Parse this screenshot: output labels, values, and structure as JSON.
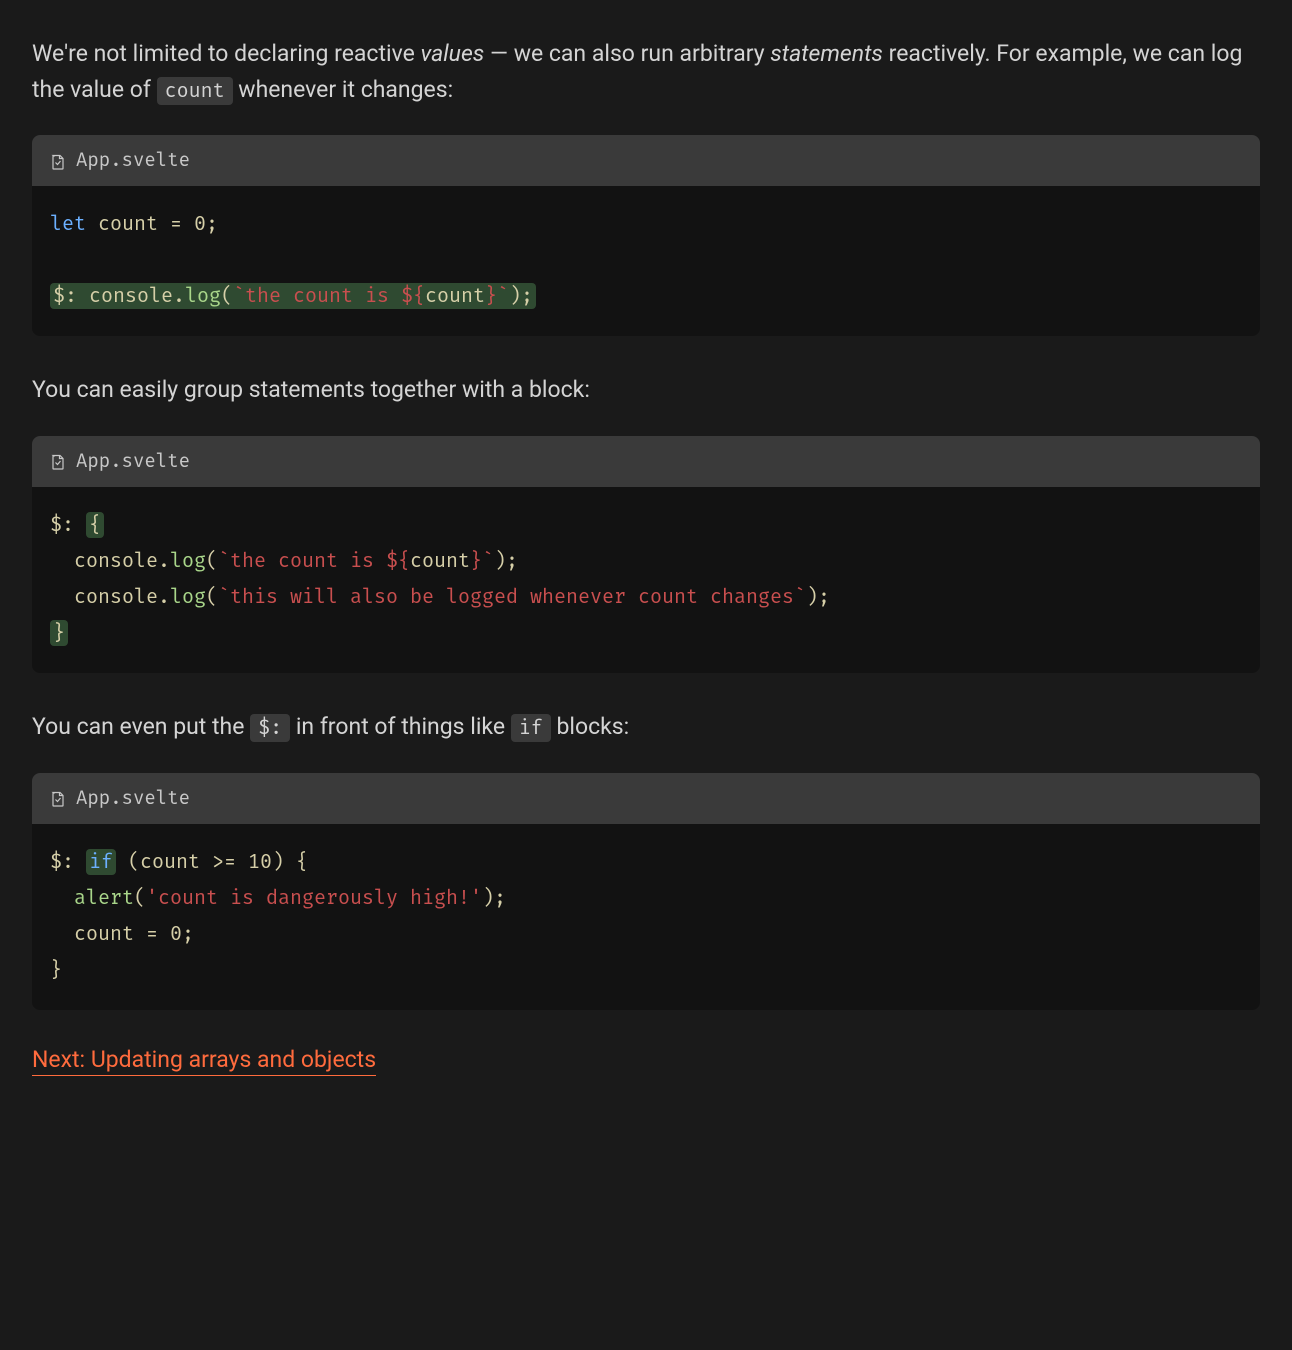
{
  "para1": {
    "pre": "We're not limited to declaring reactive ",
    "em1": "values",
    "mid": " — we can also run arbitrary ",
    "em2": "statements",
    "post1": " reactively. For example, we can log the value of ",
    "code": "count",
    "post2": " whenever it changes:"
  },
  "block1": {
    "filename": "App.svelte",
    "code": {
      "let": "let",
      "count": "count",
      "eq": " = ",
      "zero": "0",
      "semi": ";",
      "dollar": "$:",
      "console": " console.",
      "log": "log",
      "lparen": "(",
      "btick1": "`",
      "str1": "the count is ",
      "interp_open": "${",
      "interp_var": "count",
      "interp_close": "}",
      "btick2": "`",
      "rparen_semi": ");"
    }
  },
  "para2": "You can easily group statements together with a block:",
  "block2": {
    "filename": "App.svelte",
    "code": {
      "dollar": "$:",
      "lbrace": "{",
      "indent": "  ",
      "console": "console.",
      "log": "log",
      "lparen": "(",
      "btick1": "`",
      "str1": "the count is ",
      "interp_open": "${",
      "interp_var": "count",
      "interp_close": "}",
      "btick2": "`",
      "rparen_semi": ");",
      "str2": "this will also be logged whenever count changes",
      "rbrace": "}"
    }
  },
  "para3": {
    "pre": "You can even put the ",
    "code1": "$:",
    "mid": " in front of things like ",
    "code2": "if",
    "post": " blocks:"
  },
  "block3": {
    "filename": "App.svelte",
    "code": {
      "dollar": "$:",
      "if": "if",
      "cond_open": " (",
      "cond_var": "count",
      "cond_op": " >= ",
      "cond_num": "10",
      "cond_close": ")",
      "lbrace": " {",
      "indent": "  ",
      "alert": "alert",
      "lparen": "(",
      "str": "'count is dangerously high!'",
      "rparen_semi": ");",
      "assign_var": "count",
      "assign_eq": " = ",
      "assign_zero": "0",
      "assign_semi": ";",
      "rbrace": "}"
    }
  },
  "next": "Next: Updating arrays and objects"
}
